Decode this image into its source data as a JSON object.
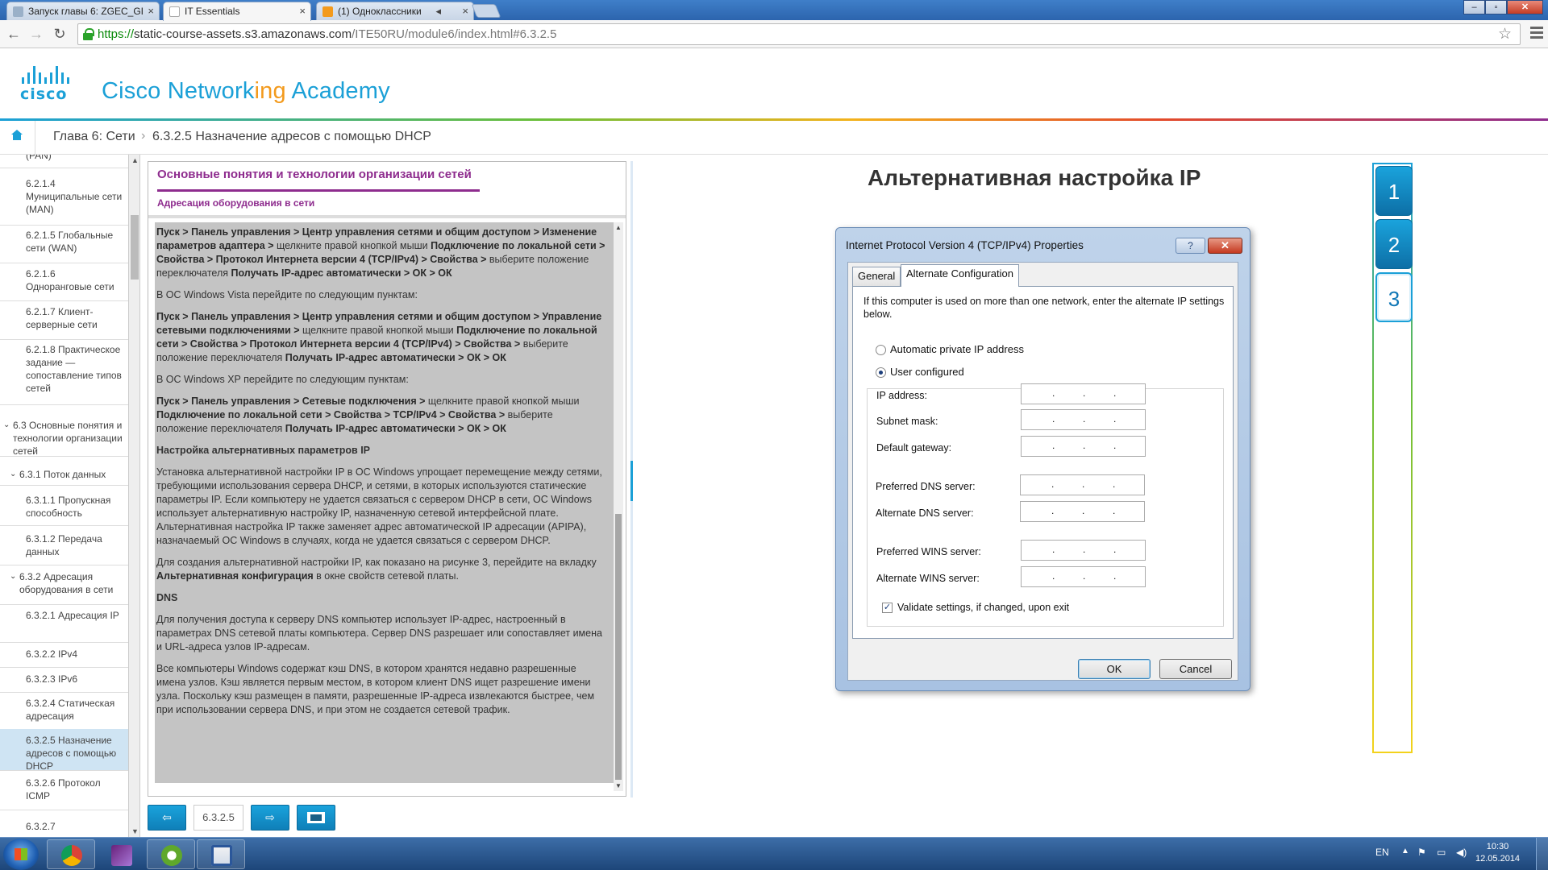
{
  "browser": {
    "tabs": [
      {
        "title": "Запуск главы 6: ZGEC_GI"
      },
      {
        "title": "IT Essentials"
      },
      {
        "title": "(1) Одноклассники"
      }
    ],
    "url": {
      "scheme": "https://",
      "host": "static-course-assets.s3.amazonaws.com",
      "path": "/ITE50RU/module6/index.html#6.3.2.5"
    }
  },
  "brand": {
    "logo_word": "cisco",
    "name_part1": "Cisco Network",
    "name_part2": "ing",
    "name_part3": " Academy"
  },
  "breadcrumb": {
    "chapter": "Глава 6: Сети",
    "section": "6.3.2.5 Назначение адресов с помощью DHCP"
  },
  "sidebar": {
    "items": [
      {
        "label": "(PAN)"
      },
      {
        "label": "6.2.1.4 Муниципальные сети (MAN)"
      },
      {
        "label": "6.2.1.5 Глобальные сети (WAN)"
      },
      {
        "label": "6.2.1.6 Одноранговые сети"
      },
      {
        "label": "6.2.1.7 Клиент-серверные сети"
      },
      {
        "label": "6.2.1.8 Практическое задание — сопоставление типов сетей"
      },
      {
        "label": "6.3 Основные понятия и технологии организации сетей"
      },
      {
        "label": "6.3.1 Поток данных"
      },
      {
        "label": "6.3.1.1 Пропускная способность"
      },
      {
        "label": "6.3.1.2 Передача данных"
      },
      {
        "label": "6.3.2 Адресация оборудования в сети"
      },
      {
        "label": "6.3.2.1 Адресация IP"
      },
      {
        "label": "6.3.2.2 IPv4"
      },
      {
        "label": "6.3.2.3 IPv6"
      },
      {
        "label": "6.3.2.4 Статическая адресация"
      },
      {
        "label": "6.3.2.5 Назначение адресов с помощью DHCP"
      },
      {
        "label": "6.3.2.6 Протокол ICMP"
      },
      {
        "label": "6.3.2.7"
      }
    ],
    "selected_index": 15
  },
  "content": {
    "title": "Основные понятия и технологии организации сетей",
    "subtitle": "Адресация оборудования в сети",
    "p1": {
      "a": "Пуск > Панель управления > Центр управления сетями и общим доступом > Изменение параметров адаптера >",
      "b": " щелкните правой кнопкой мыши ",
      "c": "Подключение по локальной сети > Свойства > Протокол Интернета версии 4 (TCP/IPv4) > Свойства >",
      "d": " выберите положение переключателя ",
      "e": "Получать IP-адрес автоматически > ОК > ОК"
    },
    "p2": "В ОС Windows Vista перейдите по следующим пунктам:",
    "p3": {
      "a": "Пуск > Панель управления > Центр управления сетями и общим доступом > Управление сетевыми подключениями >",
      "b": " щелкните правой кнопкой мыши ",
      "c": "Подключение по локальной сети > Свойства > Протокол Интернета версии 4 (TCP/IPv4) > Свойства >",
      "d": " выберите положение переключателя ",
      "e": "Получать IP-адрес автоматически > ОК > ОК"
    },
    "p4": "В ОС Windows XP перейдите по следующим пунктам:",
    "p5": {
      "a": "Пуск > Панель управления > Сетевые подключения >",
      "b": " щелкните правой кнопкой мыши ",
      "c": "Подключение по локальной сети > Свойства > TCP/IPv4 > Свойства >",
      "d": " выберите положение переключателя ",
      "e": "Получать IP-адрес автоматически > ОК > ОК"
    },
    "h1": "Настройка альтернативных параметров IP",
    "p6": "Установка альтернативной настройки IP в ОС Windows упрощает перемещение между сетями, требующими использования сервера DHCP, и сетями, в которых используются статические параметры IP. Если компьютеру не удается связаться с сервером DHCP в сети, ОС Windows использует альтернативную настройку IP, назначенную сетевой интерфейсной плате. Альтернативная настройка IP также заменяет адрес автоматической IP адресации (APIPA), назначаемый ОС Windows в случаях, когда не удается связаться с сервером DHCP.",
    "p7": {
      "a": "Для создания альтернативной настройки IP, как показано на рисунке 3, перейдите на вкладку ",
      "b": "Альтернативная конфигурация",
      "c": " в окне свойств сетевой платы."
    },
    "h2": "DNS",
    "p8": "Для получения доступа к серверу DNS компьютер использует IP-адрес, настроенный в параметрах DNS сетевой платы компьютера. Сервер DNS разрешает или сопоставляет имена и URL-адреса узлов IP-адресам.",
    "p9": "Все компьютеры Windows содержат кэш DNS, в котором хранятся недавно разрешенные имена узлов. Кэш является первым местом, в котором клиент DNS ищет разрешение имени узла. Поскольку кэш размещен в памяти, разрешенные IP-адреса извлекаются быстрее, чем при использовании сервера DNS, и при этом не создается сетевой трафик."
  },
  "pager": {
    "current": "6.3.2.5"
  },
  "slide": {
    "title": "Альтернативная настройка IP",
    "dialog": {
      "title": "Internet Protocol Version 4 (TCP/IPv4) Properties",
      "help": "?",
      "close": "✕",
      "tabs": [
        "General",
        "Alternate Configuration"
      ],
      "intro": "If this computer is used on more than one network, enter the alternate IP settings below.",
      "radio_auto": "Automatic private IP address",
      "radio_user": "User configured",
      "fields": [
        "IP address:",
        "Subnet mask:",
        "Default gateway:",
        "Preferred DNS server:",
        "Alternate DNS server:",
        "Preferred WINS server:",
        "Alternate WINS server:"
      ],
      "checkbox": "Validate settings, if changed, upon exit",
      "ok": "OK",
      "cancel": "Cancel"
    },
    "steps": [
      "1",
      "2",
      "3"
    ]
  },
  "taskbar": {
    "lang": "EN",
    "time": "10:30",
    "date": "12.05.2014"
  },
  "colors": {
    "accent": "#1ba0d7",
    "purple": "#8e2c8e",
    "orange": "#f39a1c"
  }
}
